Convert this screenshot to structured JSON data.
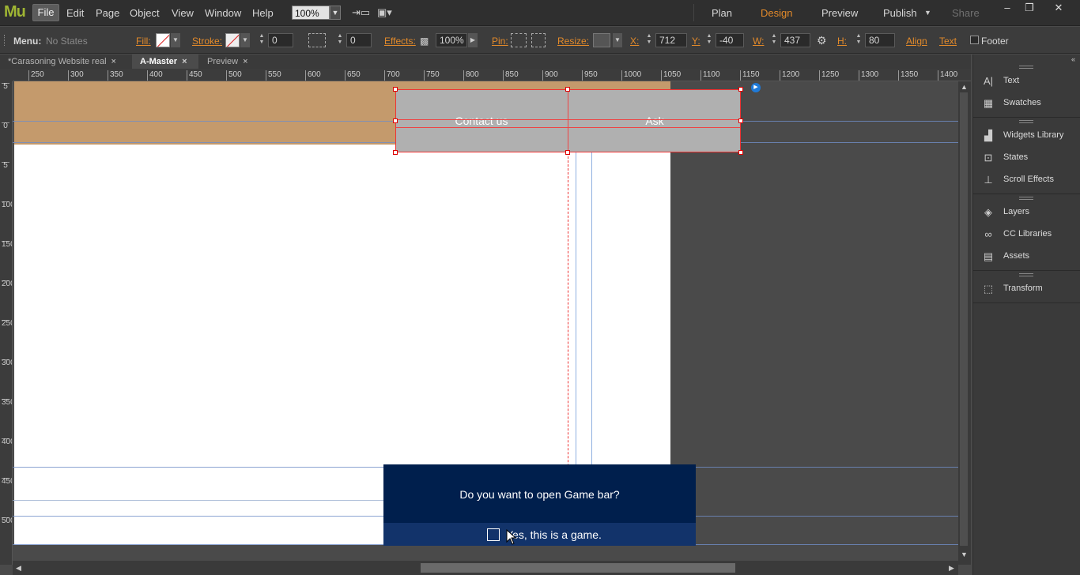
{
  "app": {
    "logo": "Mu",
    "menu": [
      "File",
      "Edit",
      "Page",
      "Object",
      "View",
      "Window",
      "Help"
    ],
    "zoom": "100%",
    "modes": [
      "Plan",
      "Design",
      "Preview",
      "Publish",
      "Share"
    ],
    "window_controls": [
      "–",
      "❐",
      "✕"
    ]
  },
  "properties": {
    "menu_label": "Menu:",
    "menu_state": "No States",
    "fill": "Fill:",
    "stroke": "Stroke:",
    "stroke_value": "0",
    "corner_value": "0",
    "effects": "Effects:",
    "opacity": "100%",
    "pin": "Pin:",
    "resize": "Resize:",
    "x_label": "X:",
    "x": "712",
    "y_label": "Y:",
    "y": "-40",
    "w_label": "W:",
    "w": "437",
    "h_label": "H:",
    "h": "80",
    "align": "Align",
    "text": "Text",
    "footer": "Footer"
  },
  "tabs": [
    {
      "label": "*Carasoning Website real",
      "close": "×"
    },
    {
      "label": "A-Master",
      "close": "×"
    },
    {
      "label": "Preview",
      "close": "×"
    }
  ],
  "ruler_h": [
    "250",
    "300",
    "350",
    "400",
    "450",
    "500",
    "550",
    "600",
    "650",
    "700",
    "750",
    "800",
    "850",
    "900",
    "950",
    "1000",
    "1050",
    "1100",
    "1150",
    "1200",
    "1250",
    "1300",
    "1350",
    "1400"
  ],
  "ruler_v": [
    "5",
    "0",
    "5",
    "100",
    "150",
    "200",
    "250",
    "300",
    "350",
    "400",
    "450",
    "500"
  ],
  "canvas": {
    "menu_items": [
      "Contact us",
      "Ask"
    ]
  },
  "panel": {
    "items": [
      {
        "label": "Text",
        "icon": "A|"
      },
      {
        "label": "Swatches",
        "icon": "▦"
      },
      {
        "label": "Widgets Library",
        "icon": "▟"
      },
      {
        "label": "States",
        "icon": "⊡"
      },
      {
        "label": "Scroll Effects",
        "icon": "⊥"
      },
      {
        "label": "Layers",
        "icon": "◈"
      },
      {
        "label": "CC Libraries",
        "icon": "∞"
      },
      {
        "label": "Assets",
        "icon": "▤"
      },
      {
        "label": "Transform",
        "icon": "⬚"
      }
    ]
  },
  "gamebar": {
    "question": "Do you want to open Game bar?",
    "checkbox_label": "Yes, this is a game."
  }
}
